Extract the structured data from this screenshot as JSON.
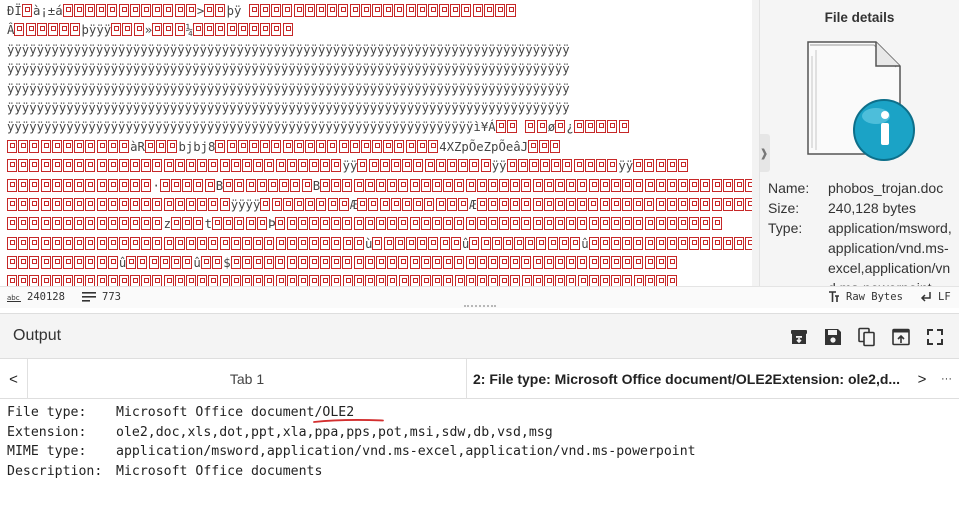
{
  "input": {
    "hex_lines": [
      {
        "pre": "ÐÏ",
        "g1": 1,
        "t": "à¡±á",
        "g2": 12,
        "t2": ">",
        "g3": 2,
        "t3": "þÿ   ",
        "g4": 24
      },
      {
        "pre": "Â",
        "g1": 6,
        "t": "þÿÿÿ",
        "g2": 3,
        "t2": "»",
        "g3": 3,
        "t3": "¼",
        "g4": 9
      },
      {
        "pre": "ÿÿÿÿÿÿÿÿÿÿÿÿÿÿÿÿÿÿÿÿÿÿÿÿÿÿÿÿÿÿÿÿÿÿÿÿÿÿÿÿÿÿÿÿÿÿÿÿÿÿÿÿÿÿÿÿÿÿÿÿÿÿÿÿÿÿÿÿÿÿÿÿÿÿÿÿ",
        "g1": 0,
        "t": "",
        "g2": 0,
        "t2": "",
        "g3": 0,
        "t3": "",
        "g4": 0
      },
      {
        "pre": "ÿÿÿÿÿÿÿÿÿÿÿÿÿÿÿÿÿÿÿÿÿÿÿÿÿÿÿÿÿÿÿÿÿÿÿÿÿÿÿÿÿÿÿÿÿÿÿÿÿÿÿÿÿÿÿÿÿÿÿÿÿÿÿÿÿÿÿÿÿÿÿÿÿÿÿÿ",
        "g1": 0,
        "t": "",
        "g2": 0,
        "t2": "",
        "g3": 0,
        "t3": "",
        "g4": 0
      },
      {
        "pre": "ÿÿÿÿÿÿÿÿÿÿÿÿÿÿÿÿÿÿÿÿÿÿÿÿÿÿÿÿÿÿÿÿÿÿÿÿÿÿÿÿÿÿÿÿÿÿÿÿÿÿÿÿÿÿÿÿÿÿÿÿÿÿÿÿÿÿÿÿÿÿÿÿÿÿÿÿ",
        "g1": 0,
        "t": "",
        "g2": 0,
        "t2": "",
        "g3": 0,
        "t3": "",
        "g4": 0
      },
      {
        "pre": "ÿÿÿÿÿÿÿÿÿÿÿÿÿÿÿÿÿÿÿÿÿÿÿÿÿÿÿÿÿÿÿÿÿÿÿÿÿÿÿÿÿÿÿÿÿÿÿÿÿÿÿÿÿÿÿÿÿÿÿÿÿÿÿÿÿÿÿÿÿÿÿÿÿÿÿÿ",
        "g1": 0,
        "t": "",
        "g2": 0,
        "t2": "",
        "g3": 0,
        "t3": "",
        "g4": 0
      },
      {
        "pre": "ÿÿÿÿÿÿÿÿÿÿÿÿÿÿÿÿÿÿÿÿÿÿÿÿÿÿÿÿÿÿÿÿÿÿÿÿÿÿÿÿÿÿÿÿÿÿÿÿÿÿÿÿÿÿÿÿÿÿÿÿÿÿÿì¥Á",
        "g1": 2,
        "t": " ",
        "g2": 2,
        "t2": "ø",
        "g3": 1,
        "t3": "¿",
        "g4": 5
      },
      {
        "pre": "",
        "g1": 11,
        "t": "àR",
        "g2": 3,
        "t2": "bjbj8",
        "g3": 20,
        "t3": "4XZpÕeZpÕeâJ",
        "g4": 3
      },
      {
        "pre": "",
        "g1": 30,
        "t": "ÿÿ",
        "g2": 12,
        "t2": "ÿÿ",
        "g3": 10,
        "t3": "ÿÿ",
        "g4": 5
      },
      {
        "pre": "",
        "g1": 13,
        "t": "·",
        "g2": 5,
        "t2": "B",
        "g3": 8,
        "t3": "B",
        "g4": 40
      },
      {
        "pre": "",
        "g1": 20,
        "t": "ÿÿÿÿ",
        "g2": 8,
        "t2": "Æ",
        "g3": 10,
        "t3": "Æ",
        "g4": 30
      },
      {
        "pre": "",
        "g1": 14,
        "t": "z",
        "g2": 3,
        "t2": "t",
        "g3": 5,
        "t3": "Þ",
        "g4": 40
      },
      {
        "pre": "",
        "g1": 32,
        "t": "ù",
        "g2": 8,
        "t2": "û",
        "g3": 10,
        "t3": "û",
        "g4": 20
      },
      {
        "pre": "",
        "g1": 10,
        "t": "û",
        "g2": 6,
        "t2": "û",
        "g3": 2,
        "t3": "$",
        "g4": 40
      },
      {
        "pre": "",
        "g1": 60,
        "t": "",
        "g2": 0,
        "t2": "",
        "g3": 0,
        "t3": "",
        "g4": 0
      }
    ]
  },
  "details": {
    "title": "File details",
    "collapse_glyph": "❱",
    "name_label": "Name:",
    "name": "phobos_trojan.doc",
    "size_label": "Size:",
    "size": "240,128 bytes",
    "type_label": "Type:",
    "type": "application/msword,application/vnd.ms-excel,application/vnd.ms-powerpoint"
  },
  "status": {
    "length": "240128",
    "lines": "773",
    "encoding": "Raw Bytes",
    "eol": "LF"
  },
  "output": {
    "title": "Output",
    "tab_prev": "<",
    "tab_next": ">",
    "tab_more": "···",
    "tab1_label": "Tab 1",
    "tab2_label": "2: File type: Microsoft Office document/OLE2Extension: ole2,d...",
    "lines": [
      {
        "label": "File type:",
        "value": "Microsoft Office document/OLE2"
      },
      {
        "label": "Extension:",
        "value": "ole2,doc,xls,dot,ppt,xla,ppa,pps,pot,msi,sdw,db,vsd,msg"
      },
      {
        "label": "MIME type:",
        "value": "application/msword,application/vnd.ms-excel,application/vnd.ms-powerpoint"
      },
      {
        "label": "Description:",
        "value": "Microsoft Office documents"
      }
    ]
  },
  "colors": {
    "glyph_box": "#c62828",
    "annotation": "#d32f2f",
    "header_bg": "#f4f4f4"
  }
}
